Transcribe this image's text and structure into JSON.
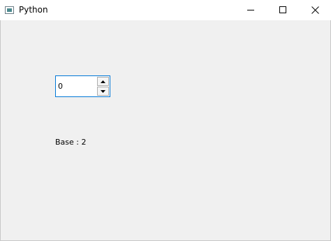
{
  "window": {
    "title": "Python",
    "icons": {
      "app": "python-app-icon",
      "minimize": "minimize-icon",
      "maximize": "maximize-icon",
      "close": "close-icon"
    }
  },
  "spinbox": {
    "value": "0",
    "up_icon": "arrow-up-icon",
    "down_icon": "arrow-down-icon",
    "accent": "#0078d7"
  },
  "label": {
    "text": "Base : 2"
  },
  "colors": {
    "client_bg": "#f0f0f0",
    "focus_border": "#0078d7"
  }
}
